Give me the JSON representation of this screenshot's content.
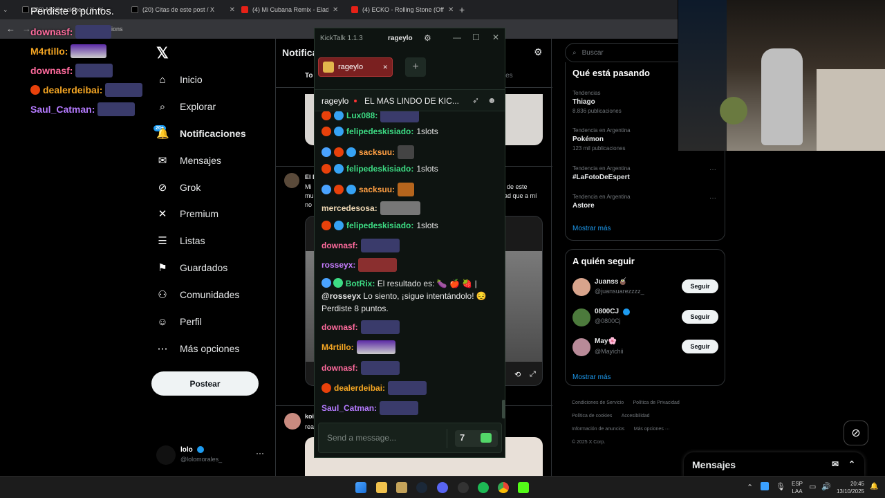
{
  "browser": {
    "tabs": [
      {
        "title": "(20) Notificaciones / X"
      },
      {
        "title": "(20) Citas de este post / X"
      },
      {
        "title": "(4) Mi Cubana Remix - Eladio C"
      },
      {
        "title": "(4) ECKO - Rolling Stone (Offici"
      }
    ],
    "address_partial": "notifications",
    "new_tab": "+"
  },
  "overlay": {
    "top_text": "Perdiste 8 puntos.",
    "lines": [
      {
        "user": "downasf:",
        "color": "#ff6b9d"
      },
      {
        "user": "M4rtillo:",
        "color": "#f5a623"
      },
      {
        "user": "downasf:",
        "color": "#ff6b9d"
      },
      {
        "user": "dealerdeibai:",
        "color": "#f5a623"
      },
      {
        "user": "Saul_Catman:",
        "color": "#b57bff"
      }
    ]
  },
  "x_nav": {
    "items": [
      {
        "label": "Inicio",
        "icon": "home-icon",
        "glyph": "⌂"
      },
      {
        "label": "Explorar",
        "icon": "search-icon",
        "glyph": "⌕"
      },
      {
        "label": "Notificaciones",
        "icon": "bell-icon",
        "glyph": "🔔"
      },
      {
        "label": "Mensajes",
        "icon": "mail-icon",
        "glyph": "✉"
      },
      {
        "label": "Grok",
        "icon": "grok-icon",
        "glyph": "⊘"
      },
      {
        "label": "Premium",
        "icon": "x-icon",
        "glyph": "✕"
      },
      {
        "label": "Listas",
        "icon": "list-icon",
        "glyph": "☰"
      },
      {
        "label": "Guardados",
        "icon": "bookmark-icon",
        "glyph": "⚑"
      },
      {
        "label": "Comunidades",
        "icon": "people-icon",
        "glyph": "⚇"
      },
      {
        "label": "Perfil",
        "icon": "person-icon",
        "glyph": "☺"
      },
      {
        "label": "Más opciones",
        "icon": "more-icon",
        "glyph": "⋯"
      }
    ],
    "badge": "20+",
    "post_button": "Postear",
    "profile_name": "lolo",
    "profile_handle": "@lolomorales_"
  },
  "feed": {
    "title": "Notifica",
    "tab_first": "To",
    "tab_partial": "ones",
    "post_name_partial": "El D",
    "post_text_1": "Mi",
    "post_text_2": "mu",
    "post_text_3": "no",
    "side_text_1": "de este",
    "side_text_2": "ad que a mí",
    "post2_name": "koi",
    "post2_text": "rea"
  },
  "right": {
    "search_placeholder": "Buscar",
    "trends_title": "Qué está pasando",
    "trends": [
      {
        "cat": "Tendencias",
        "name": "Thiago",
        "count": "8.836 publicaciones"
      },
      {
        "cat": "Tendencia en Argentina",
        "name": "Pokémon",
        "count": "123 mil publicaciones"
      },
      {
        "cat": "Tendencia en Argentina",
        "name": "#LaFotoDeEspert",
        "count": ""
      },
      {
        "cat": "Tendencia en Argentina",
        "name": "Astore",
        "count": ""
      }
    ],
    "show_more": "Mostrar más",
    "follow_title": "A quién seguir",
    "follow": [
      {
        "name": "Juanss🧉",
        "handle": "@juansuarezzzz_",
        "verified": false
      },
      {
        "name": "0800CJ",
        "handle": "@0800Cj",
        "verified": true
      },
      {
        "name": "May🌸",
        "handle": "@Mayichii",
        "verified": false
      }
    ],
    "follow_button": "Seguir",
    "show_more_2": "Mostrar más",
    "footer": [
      "Condiciones de Servicio",
      "Política de Privacidad",
      "Política de cookies",
      "Accesibilidad",
      "Información de anuncios",
      "Más opciones ···",
      "© 2025 X Corp."
    ],
    "messages": "Mensajes"
  },
  "kicktalk": {
    "app_title": "KickTalk 1.1.3",
    "account": "rageylo",
    "tab_channel": "rageylo",
    "stream_channel": "rageylo",
    "stream_title": "EL MAS LINDO DE KIC...",
    "input_placeholder": "Send a message...",
    "messages": [
      {
        "user": "Lux088:",
        "color": "#3ddc84",
        "text": "",
        "badges": 2
      },
      {
        "user": "felipedeskisiado:",
        "color": "#3ddc84",
        "text": "1slots",
        "badges": 2
      },
      {
        "user": "sacksuu:",
        "color": "#ff9f43",
        "text": "",
        "badges": 3
      },
      {
        "user": "felipedeskisiado:",
        "color": "#3ddc84",
        "text": "1slots",
        "badges": 2
      },
      {
        "user": "sacksuu:",
        "color": "#ff9f43",
        "text": "",
        "badges": 3
      },
      {
        "user": "mercedesosa:",
        "color": "#f0d9b5",
        "text": "",
        "badges": 0
      },
      {
        "user": "felipedeskisiado:",
        "color": "#3ddc84",
        "text": "1slots",
        "badges": 2
      },
      {
        "user": "downasf:",
        "color": "#ff6b9d",
        "text": "",
        "badges": 0
      },
      {
        "user": "rosseyx:",
        "color": "#c77dff",
        "text": "",
        "badges": 0
      }
    ],
    "bot": {
      "user": "BotRix:",
      "line1": "El resultado es: 🍆 🍎 🍓 |",
      "mention": "@rosseyx",
      "line2": "Lo siento, ¡sigue intentándolo! 😔",
      "line3": "Perdiste 8 puntos."
    },
    "messages2": [
      {
        "user": "downasf:",
        "color": "#ff6b9d"
      },
      {
        "user": "M4rtillo:",
        "color": "#f5a623"
      },
      {
        "user": "downasf:",
        "color": "#ff6b9d"
      },
      {
        "user": "dealerdeibai:",
        "color": "#f5a623"
      },
      {
        "user": "Saul_Catman:",
        "color": "#b57bff"
      }
    ]
  },
  "taskbar": {
    "lang": "ESP",
    "region": "LAA",
    "time": "20:45",
    "date": "13/10/2025"
  }
}
